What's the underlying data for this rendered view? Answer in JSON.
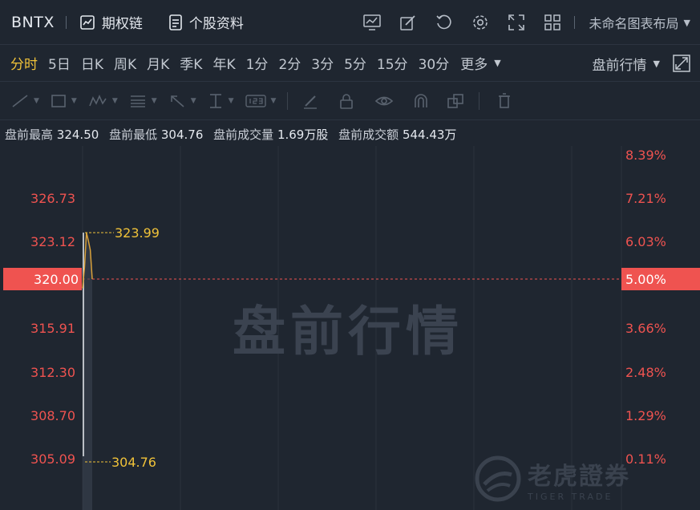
{
  "header": {
    "symbol": "BNTX",
    "options_chain": "期权链",
    "stock_profile": "个股资料",
    "layout_name": "未命名图表布局"
  },
  "periods": [
    {
      "label": "分时",
      "active": true
    },
    {
      "label": "5日"
    },
    {
      "label": "日K"
    },
    {
      "label": "周K"
    },
    {
      "label": "月K"
    },
    {
      "label": "季K"
    },
    {
      "label": "年K"
    },
    {
      "label": "1分"
    },
    {
      "label": "2分"
    },
    {
      "label": "3分"
    },
    {
      "label": "5分"
    },
    {
      "label": "15分"
    },
    {
      "label": "30分"
    }
  ],
  "more_label": "更多",
  "session_selector": "盘前行情",
  "info": {
    "high_label": "盘前最高",
    "high": "324.50",
    "low_label": "盘前最低",
    "low": "304.76",
    "volume_label": "盘前成交量",
    "volume": "1.69万股",
    "amount_label": "盘前成交额",
    "amount": "544.43万"
  },
  "watermark": "盘前行情",
  "logo": {
    "cn": "老虎證券",
    "en": "TIGER TRADE"
  },
  "colors": {
    "accent": "#f0c239",
    "down": "#ef5350",
    "line": "#d9a13a",
    "grid": "#2b323d"
  },
  "chart_data": {
    "type": "line",
    "reference_price": 320.0,
    "reference_label": "320.00",
    "reference_pct_label": "5.00%",
    "price_ticks": [
      "326.73",
      "323.12",
      "320.00",
      "315.91",
      "312.30",
      "308.70",
      "305.09"
    ],
    "pct_ticks": [
      "8.39%",
      "7.21%",
      "6.03%",
      "5.00%",
      "3.66%",
      "2.48%",
      "1.29%",
      "0.11%"
    ],
    "high_marker": {
      "label": "323.99",
      "value": 323.99
    },
    "low_marker": {
      "label": "304.76",
      "value": 304.76
    },
    "series": [
      {
        "values": [
          319.2,
          321.0,
          323.99,
          323.3,
          322.5,
          320.0
        ]
      }
    ]
  }
}
